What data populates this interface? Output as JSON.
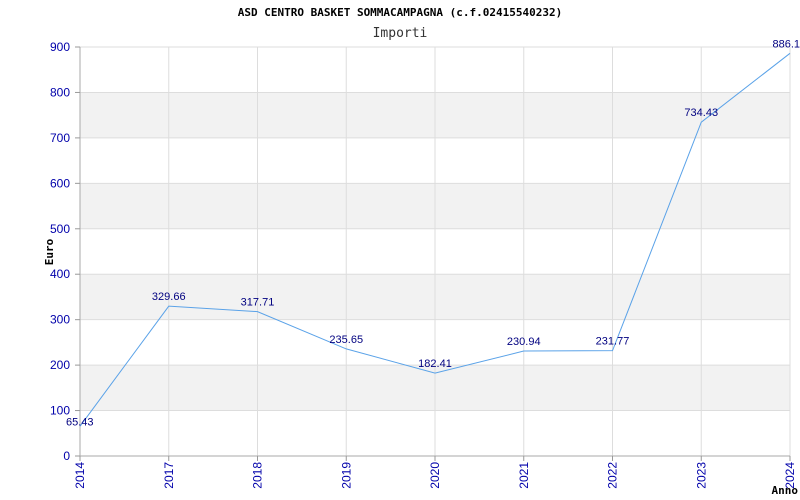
{
  "chart_data": {
    "type": "line",
    "title": "ASD CENTRO BASKET SOMMACAMPAGNA (c.f.02415540232)",
    "subtitle": "Importi",
    "xlabel": "Anno",
    "ylabel": "Euro",
    "categories": [
      "2014",
      "2017",
      "2018",
      "2019",
      "2020",
      "2021",
      "2022",
      "2023",
      "2024"
    ],
    "series": [
      {
        "values": [
          65.43,
          329.66,
          317.71,
          235.65,
          182.41,
          230.94,
          231.77,
          734.43,
          886.1
        ],
        "labels": [
          "65.43",
          "329.66",
          "317.71",
          "235.65",
          "182.41",
          "230.94",
          "231.77",
          "734.43",
          "886.1"
        ]
      }
    ],
    "ylim": [
      0,
      900
    ],
    "yticks": [
      "0",
      "100",
      "200",
      "300",
      "400",
      "500",
      "600",
      "700",
      "800",
      "900"
    ],
    "grid": true,
    "colors": {
      "line": "#5aa2e8",
      "band": "#f2f2f2",
      "grid": "#dddddd",
      "axis_text": "#0000aa",
      "label_text": "#000080"
    }
  }
}
